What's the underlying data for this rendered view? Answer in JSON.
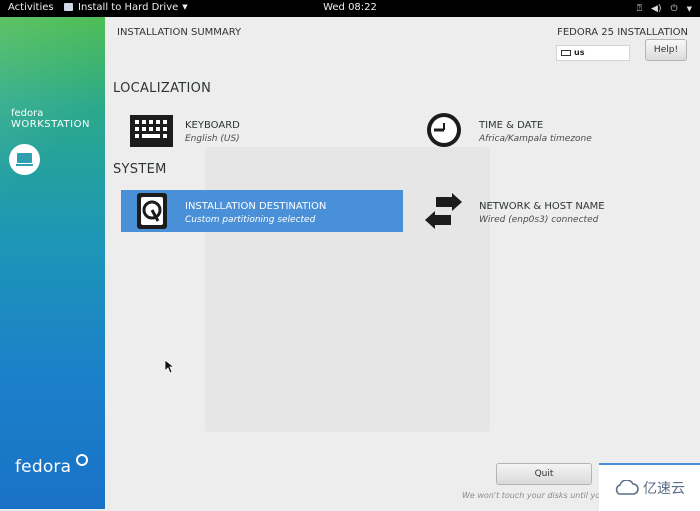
{
  "topbar": {
    "activities": "Activities",
    "app_name": "Install to Hard Drive",
    "clock": "Wed 08:22"
  },
  "sidebar": {
    "brand_small": "fedora",
    "brand_edition": "WORKSTATION",
    "brand_large": "fedora"
  },
  "header": {
    "title": "INSTALLATION SUMMARY",
    "product": "FEDORA 25 INSTALLATION",
    "keyboard_layout": "us",
    "help_label": "Help!"
  },
  "sections": {
    "localization": "LOCALIZATION",
    "system": "SYSTEM"
  },
  "spokes": {
    "keyboard": {
      "title": "KEYBOARD",
      "status": "English (US)"
    },
    "time_date": {
      "title": "TIME & DATE",
      "status": "Africa/Kampala timezone"
    },
    "install_dest": {
      "title": "INSTALLATION DESTINATION",
      "status": "Custom partitioning selected"
    },
    "network": {
      "title": "NETWORK & HOST NAME",
      "status": "Wired (enp0s3) connected"
    }
  },
  "footer": {
    "quit_label": "Quit",
    "note": "We won't touch your disks until you"
  },
  "watermark": "亿速云",
  "colors": {
    "selected": "#4a90d9",
    "sidebar_top": "#43b94a",
    "sidebar_bottom": "#1a72c6",
    "topbar": "#000000"
  },
  "icons": {
    "keyboard": "keyboard-icon",
    "clock": "clock-icon",
    "disk": "hard-drive-icon",
    "network": "network-arrows-icon"
  }
}
